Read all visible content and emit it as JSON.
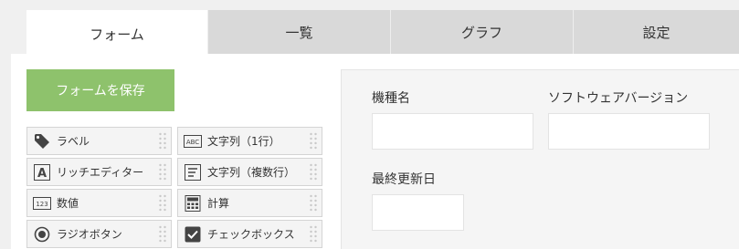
{
  "tabs": [
    {
      "label": "フォーム",
      "active": true
    },
    {
      "label": "一覧",
      "active": false
    },
    {
      "label": "グラフ",
      "active": false
    },
    {
      "label": "設定",
      "active": false
    }
  ],
  "save_button": {
    "label": "フォームを保存"
  },
  "palette": {
    "items": [
      {
        "label": "ラベル",
        "icon": "tag-icon"
      },
      {
        "label": "文字列（1行）",
        "icon": "abc-text-icon"
      },
      {
        "label": "リッチエディター",
        "icon": "rich-editor-icon"
      },
      {
        "label": "文字列（複数行）",
        "icon": "multiline-text-icon"
      },
      {
        "label": "数値",
        "icon": "number-123-icon"
      },
      {
        "label": "計算",
        "icon": "calculator-icon"
      },
      {
        "label": "ラジオボタン",
        "icon": "radio-button-icon"
      },
      {
        "label": "チェックボックス",
        "icon": "checkbox-icon"
      }
    ]
  },
  "form_fields": [
    {
      "label": "機種名",
      "value": ""
    },
    {
      "label": "ソフトウェアバージョン",
      "value": ""
    },
    {
      "label": "最終更新日",
      "value": ""
    }
  ],
  "colors": {
    "accent": "#8ec26c",
    "tab_bar": "#d9d9d9",
    "canvas": "#f5f5f5"
  }
}
